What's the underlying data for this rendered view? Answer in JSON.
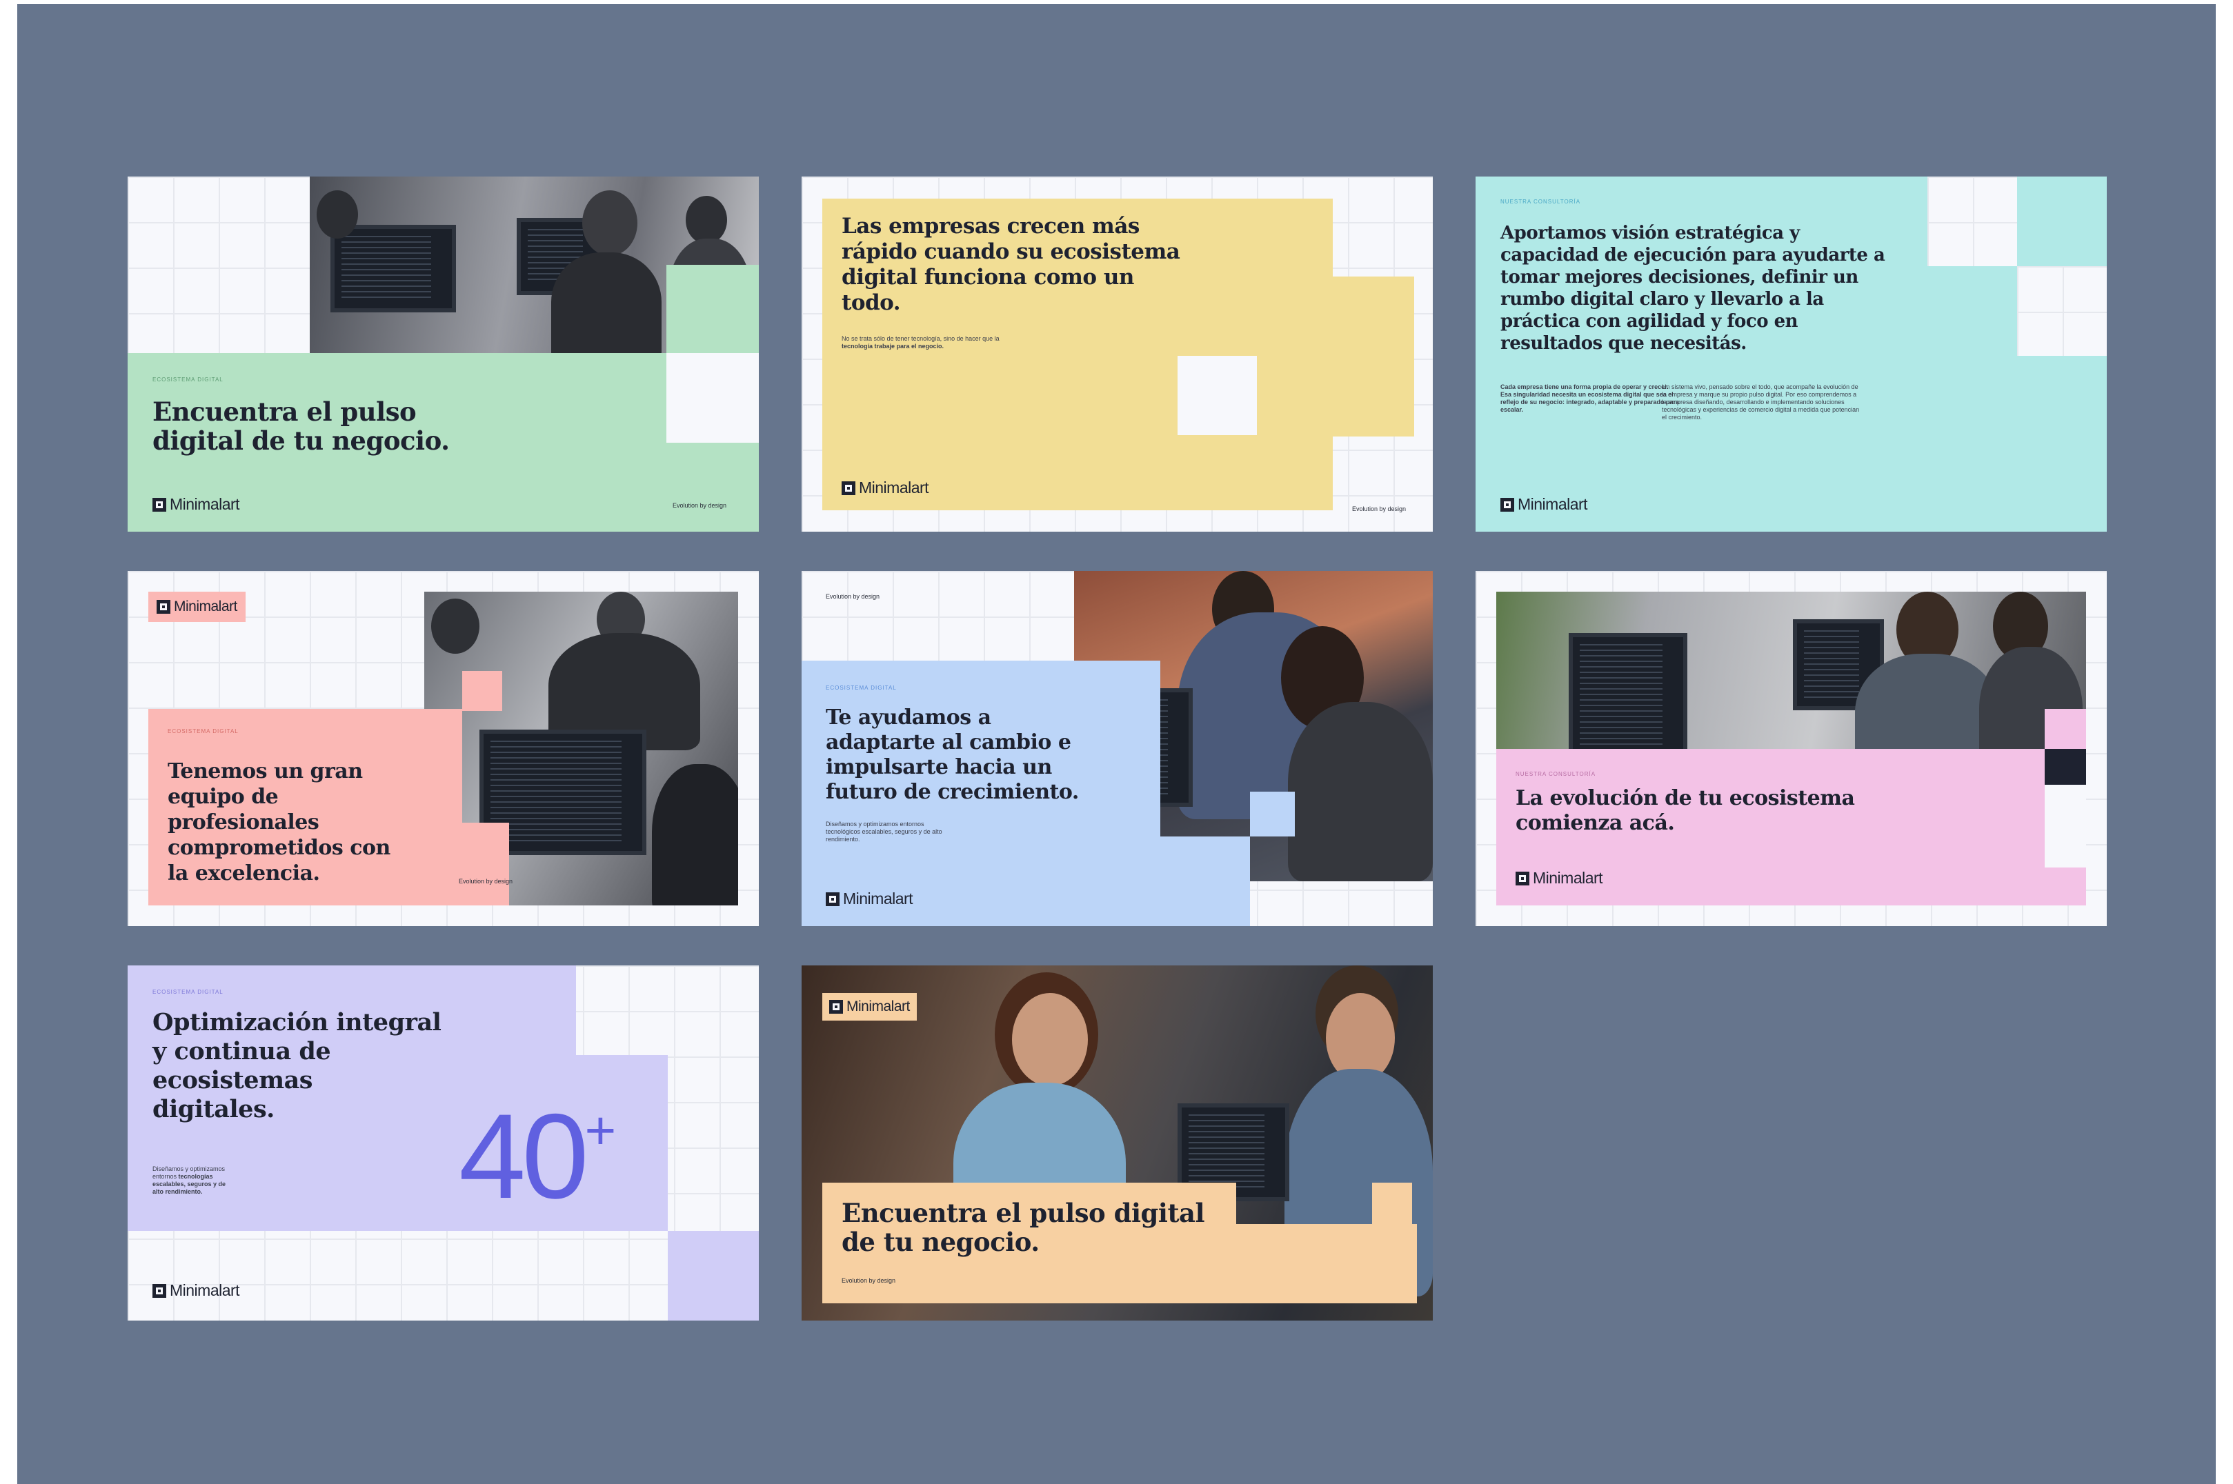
{
  "brand": {
    "logo_text": "Minimalart",
    "tagline": "Evolution by design"
  },
  "colors": {
    "background": "#66758d",
    "mint": "#b4e2c4",
    "yellow": "#f2de95",
    "aqua": "#b1e9e7",
    "salmon": "#fbb8b5",
    "blue": "#bcd5f8",
    "pink": "#f3c2e6",
    "lavender": "#d0cdf7",
    "peach": "#f7d0a2",
    "accent_purple": "#6060e0"
  },
  "slides": [
    {
      "eyebrow": "Ecosistema digital",
      "headline": "Encuentra el pulso digital de tu negocio."
    },
    {
      "headline": "Las empresas crecen más rápido cuando su ecosistema digital funciona como un todo.",
      "body_plain": "No se trata sólo de tener tecnología, sino de hacer que la",
      "body_bold": "tecnología trabaje para el negocio."
    },
    {
      "eyebrow": "Nuestra consultoría",
      "headline": "Aportamos visión estratégica y capacidad de ejecución para ayudarte a tomar mejores decisiones, definir un rumbo digital claro y llevarlo a la práctica con agilidad y foco en resultados que necesitás.",
      "col1": "Cada empresa tiene una forma propia de operar y crecer. Esa singularidad necesita un ecosistema digital que sea el reflejo de su negocio: integrado, adaptable y preparado para escalar.",
      "col2": "Un sistema vivo, pensado sobre el todo, que acompañe la evolución de la empresa y marque su propio pulso digital. Por eso comprendemos a la empresa diseñando, desarrollando e implementando soluciones tecnológicas y experiencias de comercio digital a medida que potencian el crecimiento."
    },
    {
      "eyebrow": "Ecosistema digital",
      "headline": "Tenemos un gran equipo de profesionales comprometidos con la excelencia."
    },
    {
      "eyebrow": "Ecosistema digital",
      "headline": "Te ayudamos a adaptarte al cambio e impulsarte hacia un futuro de crecimiento.",
      "body": "Diseñamos y optimizamos entornos tecnológicos escalables, seguros y de alto rendimiento."
    },
    {
      "eyebrow": "Nuestra consultoría",
      "headline": "La evolución de tu ecosistema comienza acá."
    },
    {
      "eyebrow": "Ecosistema digital",
      "headline": "Optimización integral y continua de ecosistemas digitales.",
      "stat": "40",
      "stat_suffix": "+",
      "body_plain": "Diseñamos y optimizamos entornos",
      "body_bold": "tecnologías escalables, seguros y de alto rendimiento."
    },
    {
      "headline": "Encuentra el pulso digital de tu negocio."
    }
  ]
}
